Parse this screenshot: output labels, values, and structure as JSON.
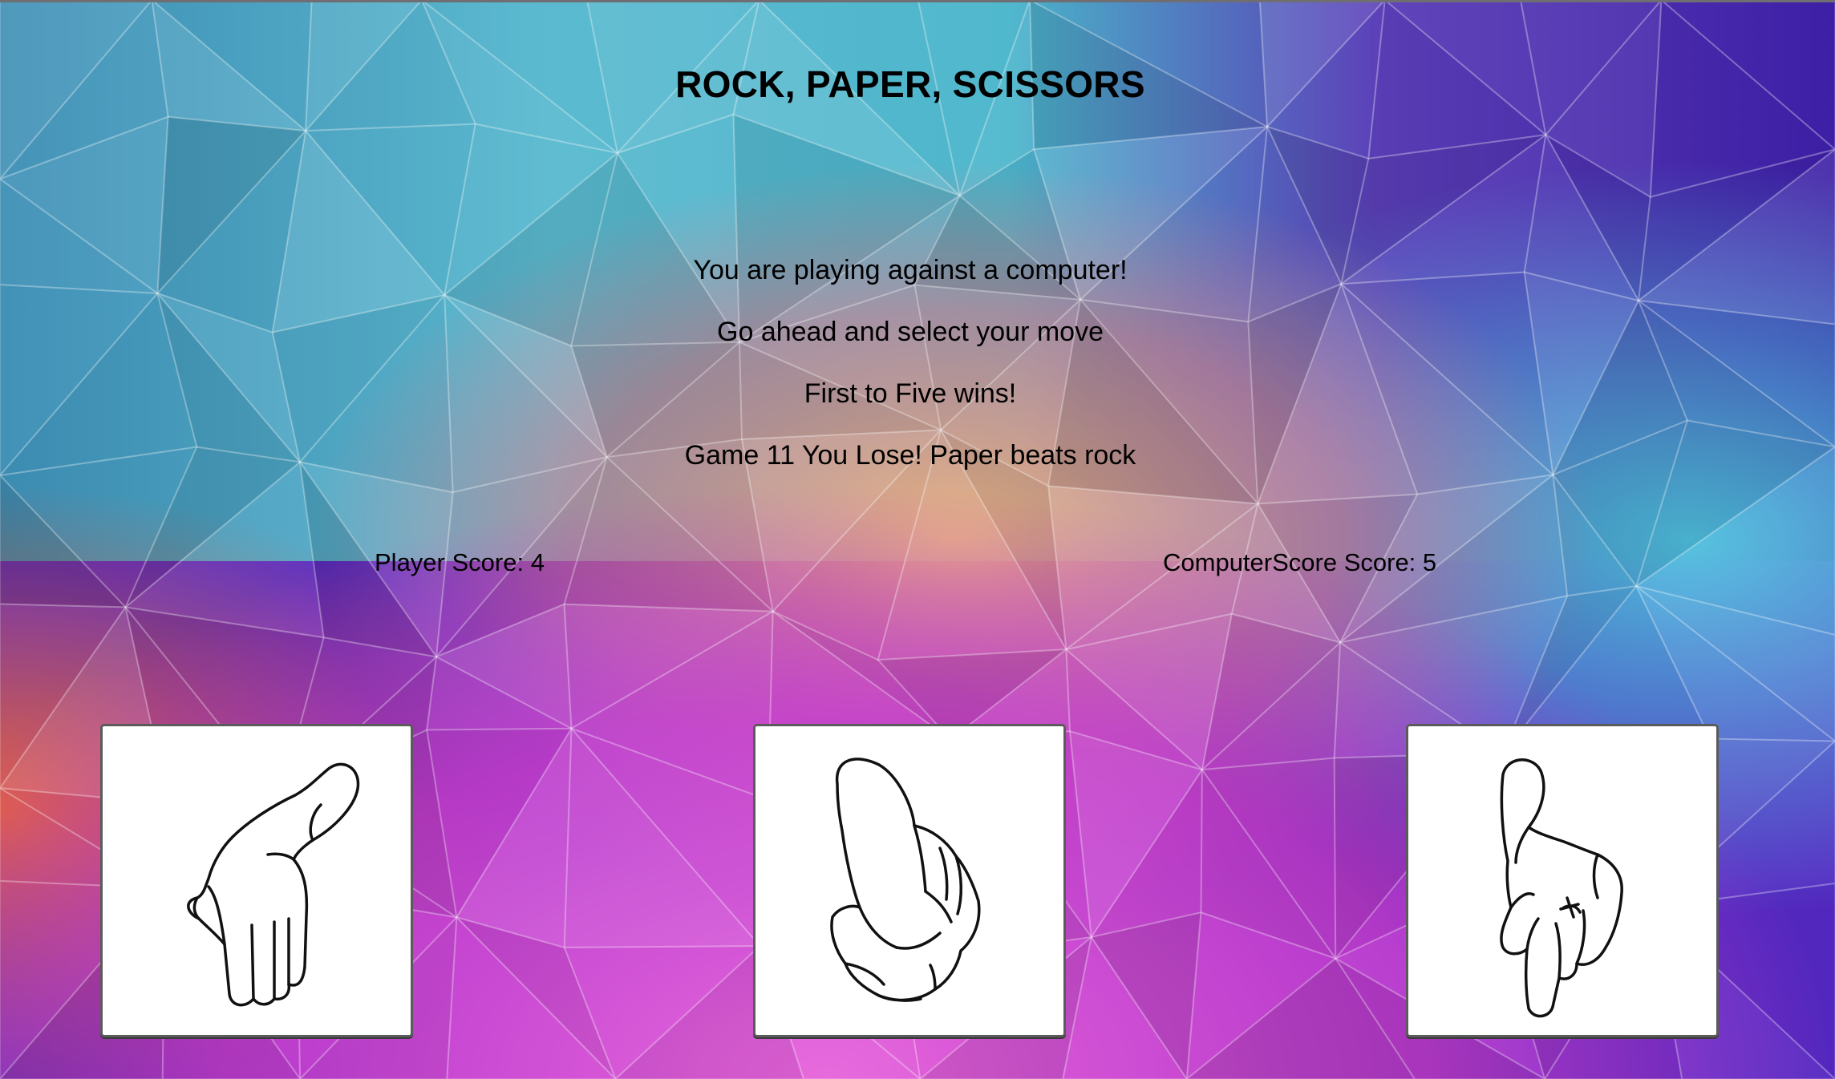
{
  "game": {
    "title": "ROCK, PAPER, SCISSORS",
    "messages": {
      "intro": "You are playing against a computer!",
      "instruction": "Go ahead and select your move",
      "rules": "First to Five wins!",
      "result": "Game 11 You Lose! Paper beats rock"
    },
    "scores": {
      "player_label": "Player Score: 4",
      "computer_label": "ComputerScore Score: 5"
    },
    "choices": [
      {
        "name": "paper",
        "icon": "open-hand-icon"
      },
      {
        "name": "rock",
        "icon": "fist-icon"
      },
      {
        "name": "scissors",
        "icon": "two-finger-hand-icon"
      }
    ]
  },
  "colors": {
    "background_top": "#4fb8cf",
    "background_purple": "#5a2bc7",
    "background_pink": "#d74ad6",
    "card_bg": "#ffffff",
    "card_border": "#5b5b5b"
  }
}
